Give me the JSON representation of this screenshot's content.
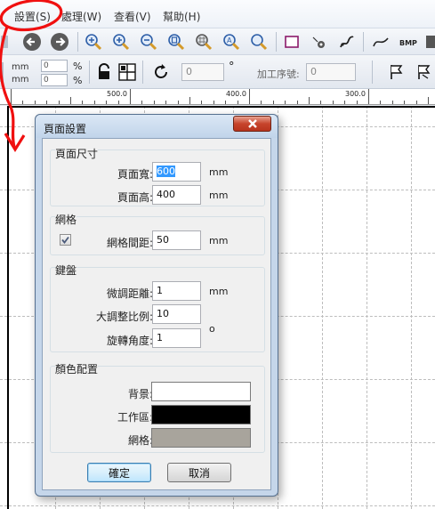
{
  "menu": [
    {
      "label": "設置(S)"
    },
    {
      "label": "處理(W)"
    },
    {
      "label": "查看(V)"
    },
    {
      "label": "幫助(H)"
    }
  ],
  "toolbar2": {
    "unit_top": "mm",
    "unit_bottom": "mm",
    "pct_top_value": "0",
    "pct_bottom_value": "0",
    "pct_symbol": "%",
    "angle_value": "0",
    "degree_symbol": "°",
    "process_order_label": "加工序號:",
    "process_order_value": "0"
  },
  "ruler": {
    "labels": [
      "500.0",
      "400.0",
      "300.0"
    ]
  },
  "dialog": {
    "title": "頁面設置",
    "page_size": {
      "title": "頁面尺寸",
      "width_label": "頁面寬:",
      "width_value": "600",
      "height_label": "頁面高:",
      "height_value": "400",
      "unit": "mm"
    },
    "grid": {
      "title": "網格",
      "spacing_label": "網格間距:",
      "spacing_value": "50",
      "unit": "mm",
      "enabled": true
    },
    "keyboard": {
      "title": "鍵盤",
      "nudge_label": "微調距離:",
      "nudge_value": "1",
      "nudge_unit": "mm",
      "scale_label": "大調整比例:",
      "scale_value": "10",
      "rotate_label": "旋轉角度:",
      "rotate_value": "1",
      "rotate_unit": "o"
    },
    "colors": {
      "title": "顏色配置",
      "background_label": "背景:",
      "background_color": "#ffffff",
      "workspace_label": "工作區:",
      "workspace_color": "#000000",
      "grid_label": "網格:",
      "grid_color": "#a8a49c"
    },
    "ok_label": "確定",
    "cancel_label": "取消"
  },
  "icons": [
    "undo-icon",
    "redo-icon",
    "zoom-in-icon",
    "zoom-plus-icon",
    "zoom-minus-icon",
    "zoom-page-icon",
    "zoom-grid-icon",
    "zoom-all-icon",
    "zoom-select-icon",
    "rectangle-icon",
    "node-icon",
    "curve-edit-icon",
    "line-icon",
    "bmp-icon",
    "lock-icon",
    "grid-align-icon",
    "rotate-icon",
    "flag-icon",
    "flag-reverse-icon"
  ]
}
